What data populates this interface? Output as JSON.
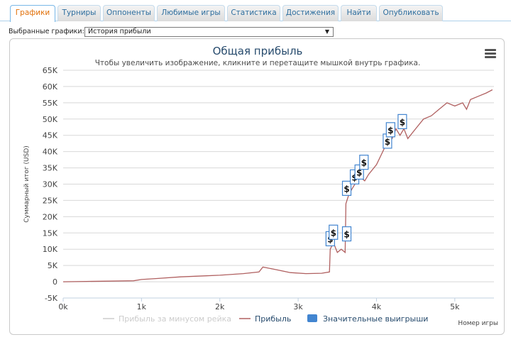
{
  "tabs": [
    {
      "label": "Графики",
      "active": true
    },
    {
      "label": "Турниры"
    },
    {
      "label": "Оппоненты"
    },
    {
      "label": "Любимые игры"
    },
    {
      "label": "Статистика"
    },
    {
      "label": "Достижения"
    },
    {
      "label": "Найти"
    },
    {
      "label": "Опубликовать"
    }
  ],
  "selector": {
    "label": "Выбранные графики:",
    "value": "История прибыли"
  },
  "chart": {
    "title": "Общая прибыль",
    "subtitle": "Чтобы увеличить изображение, кликните и перетащите мышкой внутрь графика.",
    "ylabel": "Суммарный итог (USD)",
    "xlabel": "Номер игры",
    "legend": [
      {
        "name": "Прибыль за минусом рейка",
        "color": "#cccccc",
        "kind": "line",
        "disabled": true
      },
      {
        "name": "Прибыль",
        "color": "#b06060",
        "kind": "line"
      },
      {
        "name": "Значительные выигрыши",
        "color": "#4285d0",
        "kind": "box"
      }
    ],
    "accent": "#b06060"
  },
  "chart_data": {
    "type": "line",
    "title": "Общая прибыль",
    "xlabel": "Номер игры",
    "ylabel": "Суммарный итог (USD)",
    "xlim": [
      0,
      5500
    ],
    "ylim": [
      -5000,
      65000
    ],
    "x_ticks": [
      "0k",
      "1k",
      "2k",
      "3k",
      "4k",
      "5k"
    ],
    "y_ticks": [
      "-5K",
      "0",
      "5K",
      "10K",
      "15K",
      "20K",
      "25K",
      "30K",
      "35K",
      "40K",
      "45K",
      "50K",
      "55K",
      "60K",
      "65K"
    ],
    "grid": true,
    "series": [
      {
        "name": "Прибыль",
        "x": [
          0,
          300,
          600,
          900,
          1000,
          1200,
          1500,
          1800,
          2000,
          2300,
          2500,
          2550,
          2700,
          2900,
          3100,
          3300,
          3400,
          3410,
          3450,
          3500,
          3550,
          3600,
          3610,
          3650,
          3700,
          3750,
          3800,
          3850,
          3900,
          4000,
          4100,
          4150,
          4200,
          4250,
          4300,
          4350,
          4400,
          4500,
          4600,
          4700,
          4800,
          4900,
          5000,
          5100,
          5150,
          5200,
          5300,
          5400,
          5480
        ],
        "values": [
          0,
          100,
          200,
          300,
          700,
          1000,
          1500,
          1800,
          2000,
          2500,
          3000,
          4500,
          3800,
          2800,
          2500,
          2600,
          3000,
          10000,
          12000,
          9000,
          10000,
          9000,
          24000,
          27000,
          29000,
          31000,
          32000,
          31000,
          33000,
          36000,
          41000,
          44000,
          44000,
          47000,
          45000,
          47000,
          44000,
          47000,
          50000,
          51000,
          53000,
          55000,
          54000,
          55000,
          53000,
          56000,
          57000,
          58000,
          59000
        ]
      }
    ],
    "significant_wins": [
      {
        "x": 3410,
        "y": 13000
      },
      {
        "x": 3450,
        "y": 15000
      },
      {
        "x": 3620,
        "y": 14500
      },
      {
        "x": 3620,
        "y": 28500
      },
      {
        "x": 3720,
        "y": 32000
      },
      {
        "x": 3780,
        "y": 33500
      },
      {
        "x": 3840,
        "y": 36500
      },
      {
        "x": 4140,
        "y": 43000
      },
      {
        "x": 4180,
        "y": 46500
      },
      {
        "x": 4330,
        "y": 49000
      }
    ]
  }
}
